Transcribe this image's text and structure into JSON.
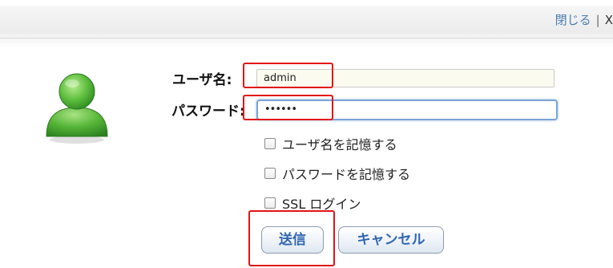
{
  "topbar": {
    "close_label": "閉じる",
    "separator": "|",
    "close_x": "X"
  },
  "form": {
    "username_label": "ユーザ名:",
    "username_value": "admin",
    "password_label": "パスワード:",
    "password_value": "••••••",
    "remember_username_label": "ユーザ名を記憶する",
    "remember_password_label": "パスワードを記憶する",
    "ssl_login_label": "SSL ログイン",
    "remember_username_checked": false,
    "remember_password_checked": false,
    "ssl_login_checked": false
  },
  "buttons": {
    "submit_label": "送信",
    "cancel_label": "キャンセル"
  },
  "icons": {
    "avatar": "user-avatar-icon"
  },
  "colors": {
    "highlight_box": "#e31414",
    "link": "#4a7db3",
    "button_text": "#2f66b2",
    "avatar_green": "#4caf3c"
  }
}
